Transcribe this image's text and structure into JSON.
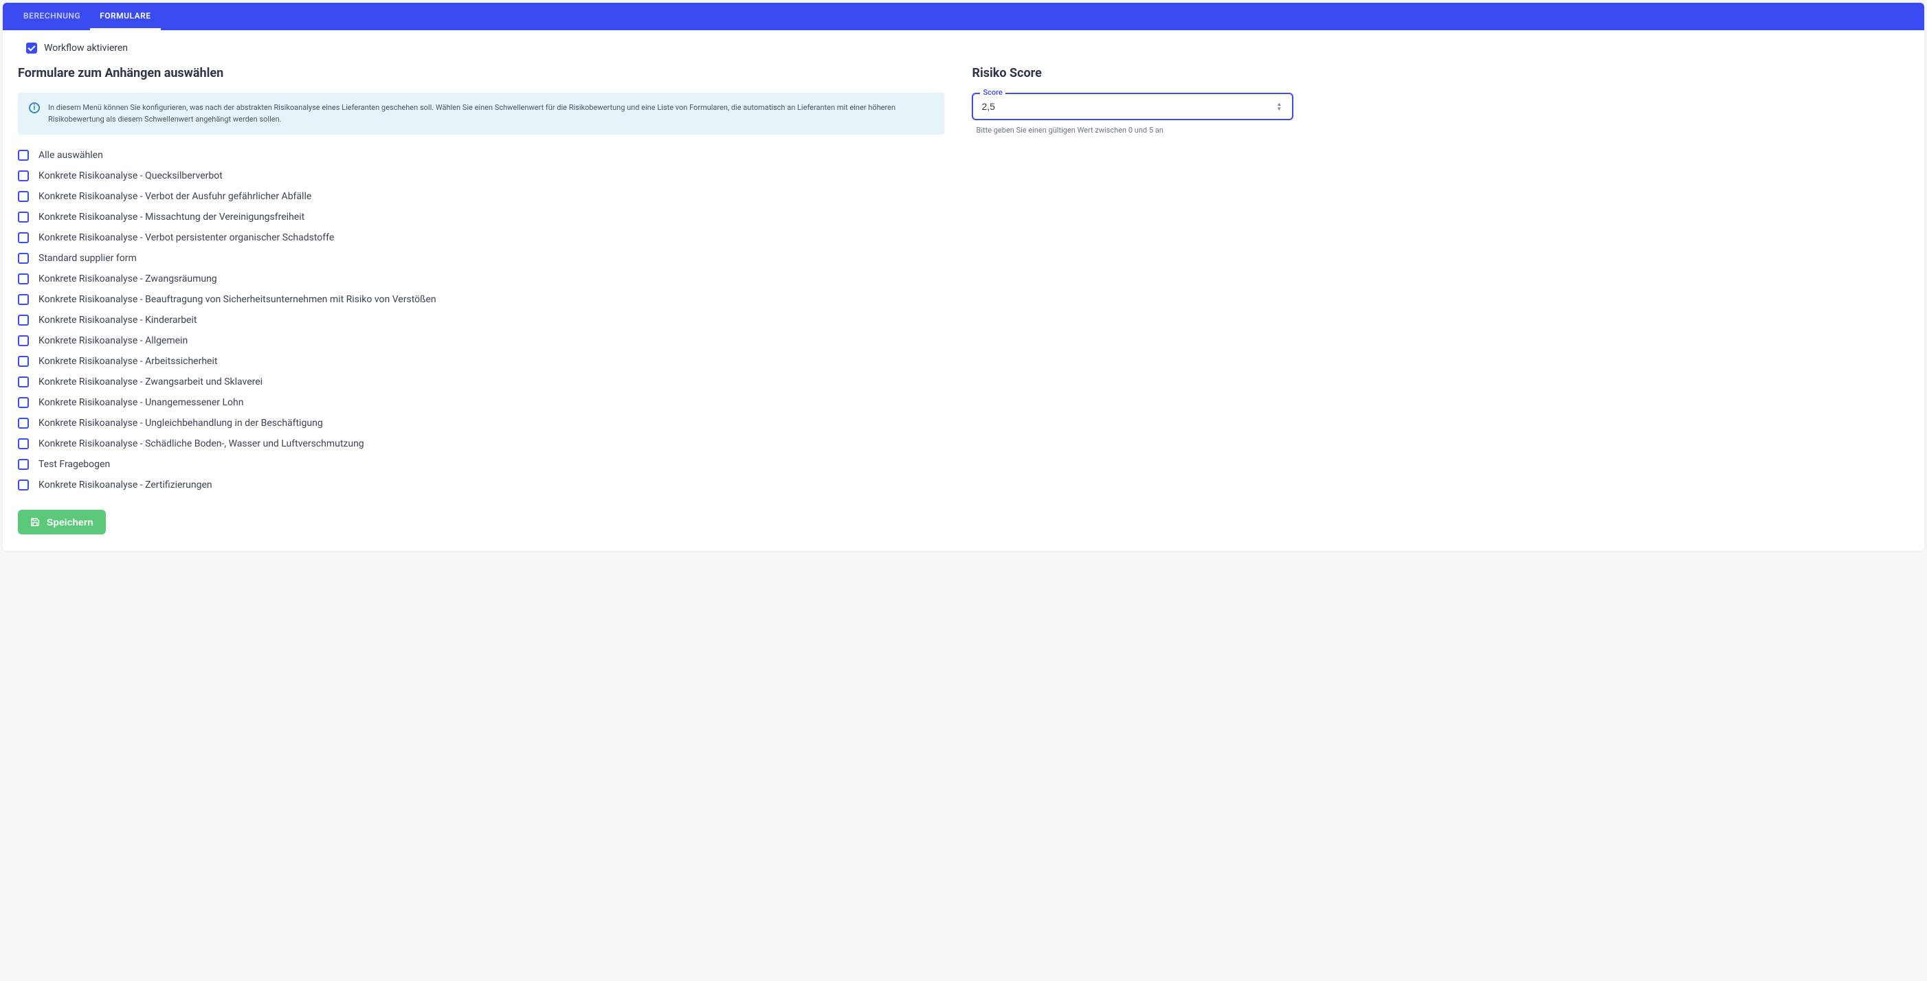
{
  "tabs": {
    "berechnung": "BERECHNUNG",
    "formulare": "FORMULARE"
  },
  "workflow": {
    "label": "Workflow aktivieren",
    "checked": true
  },
  "forms_section": {
    "title": "Formulare zum Anhängen auswählen",
    "info": "In diesem Menü können Sie konfigurieren, was nach der abstrakten Risikoanalyse eines Lieferanten geschehen soll. Wählen Sie einen Schwellenwert für die Risikobewertung und eine Liste von Formularen, die automatisch an Lieferanten mit einer höheren Risikobewertung als diesem Schwellenwert angehängt werden sollen.",
    "select_all": "Alle auswählen",
    "items": [
      "Konkrete Risikoanalyse - Quecksilberverbot",
      "Konkrete Risikoanalyse - Verbot der Ausfuhr gefährlicher Abfälle",
      "Konkrete Risikoanalyse - Missachtung der Vereinigungsfreiheit",
      "Konkrete Risikoanalyse - Verbot persistenter organischer Schadstoffe",
      "Standard supplier form",
      "Konkrete Risikoanalyse - Zwangsräumung",
      "Konkrete Risikoanalyse - Beauftragung von Sicherheitsunternehmen mit Risiko von Verstößen",
      "Konkrete Risikoanalyse - Kinderarbeit",
      "Konkrete Risikoanalyse - Allgemein",
      "Konkrete Risikoanalyse - Arbeitssicherheit",
      "Konkrete Risikoanalyse - Zwangsarbeit und Sklaverei",
      "Konkrete Risikoanalyse - Unangemessener Lohn",
      "Konkrete Risikoanalyse - Ungleichbehandlung in der Beschäftigung",
      "Konkrete Risikoanalyse - Schädliche Boden-, Wasser und Luftverschmutzung",
      "Test Fragebogen",
      "Konkrete Risikoanalyse - Zertifizierungen"
    ]
  },
  "score": {
    "title": "Risiko Score",
    "legend": "Score",
    "value": "2,5",
    "help": "Bitte geben Sie einen gültigen Wert zwischen 0 und 5 an"
  },
  "save": {
    "label": "Speichern"
  }
}
